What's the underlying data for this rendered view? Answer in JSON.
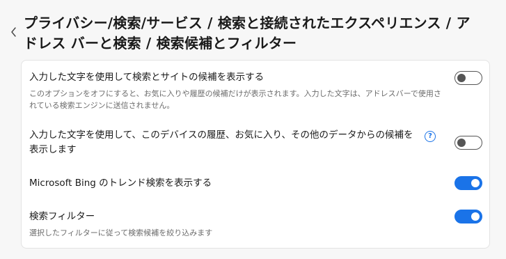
{
  "header": {
    "title": "プライバシー/検索/サービス / 検索と接続されたエクスペリエンス / アドレス バーと検索 / 検索候補とフィルター"
  },
  "settings": [
    {
      "title": "入力した文字を使用して検索とサイトの候補を表示する",
      "description": "このオプションをオフにすると、お気に入りや履歴の候補だけが表示されます。入力した文字は、アドレスバーで使用されている検索エンジンに送信されません。",
      "enabled": false
    },
    {
      "title": "入力した文字を使用して、このデバイスの履歴、お気に入り、その他のデータからの候補を表示します",
      "help_icon": "?",
      "enabled": false
    },
    {
      "title": "Microsoft Bing のトレンド検索を表示する",
      "enabled": true
    },
    {
      "title": "検索フィルター",
      "description": "選択したフィルターに従って検索候補を絞り込みます",
      "enabled": true
    }
  ],
  "colors": {
    "accent": "#1a73e8",
    "toggle_off": "#555555",
    "card_bg": "#ffffff",
    "page_bg": "#f7f7f7"
  },
  "icons": {
    "back": "chevron-left-icon",
    "help": "help-circle-icon"
  }
}
